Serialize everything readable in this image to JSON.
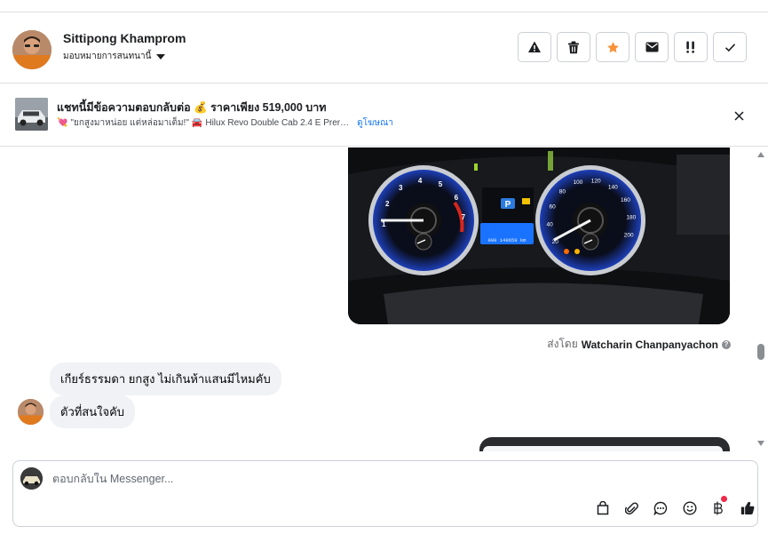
{
  "header": {
    "contact_name": "Sittipong Khamprom",
    "assign_label": "มอบหมายการสนทนานี้"
  },
  "actions": [
    {
      "name": "spam-button",
      "icon": "warning-icon"
    },
    {
      "name": "delete-button",
      "icon": "trash-icon"
    },
    {
      "name": "star-button",
      "icon": "star-icon"
    },
    {
      "name": "mark-unread-button",
      "icon": "envelope-icon"
    },
    {
      "name": "follow-up-button",
      "icon": "exclamation-icon"
    },
    {
      "name": "mark-done-button",
      "icon": "checkmark-icon"
    }
  ],
  "colors": {
    "star": "#f7923a",
    "link": "#1877f2",
    "bubble": "#f0f2f5",
    "notification": "#f02849"
  },
  "banner": {
    "title": "แชทนี้มีข้อความตอบกลับต่อ 💰 ราคาเพียง 519,000 บาท",
    "subtitle_heart": "💘",
    "subtitle_quote": "\"ยกสูงมาหน่อย แต่หล่อมาเต็ม!\"",
    "subtitle_car": "🚘",
    "subtitle_model": "Hilux Revo Double Cab 2.4 E Prer…",
    "ad_link": "ดูโฆษณา"
  },
  "messages": {
    "sent_by_prefix": "ส่งโดย",
    "sent_by_name": "Watcharin Chanpanyachon",
    "incoming_1": "เกียร์ธรรมดา ยกสูง ไม่เกินห้าแสนมีไหมคับ",
    "incoming_2": "ตัวที่สนใจคับ"
  },
  "dashboard_photo": {
    "tacho_ticks": [
      "1",
      "2",
      "3",
      "4",
      "5",
      "6",
      "7"
    ],
    "speedo_ticks": [
      "20",
      "40",
      "60",
      "80",
      "100",
      "120",
      "140",
      "160",
      "180",
      "200"
    ],
    "odometer": "000 140659 km"
  },
  "composer": {
    "placeholder": "ตอบกลับใน Messenger..."
  },
  "tools": [
    "bag-icon",
    "paperclip-icon",
    "saved-reply-icon",
    "emoji-icon",
    "baht-icon",
    "thumbs-up-icon"
  ]
}
